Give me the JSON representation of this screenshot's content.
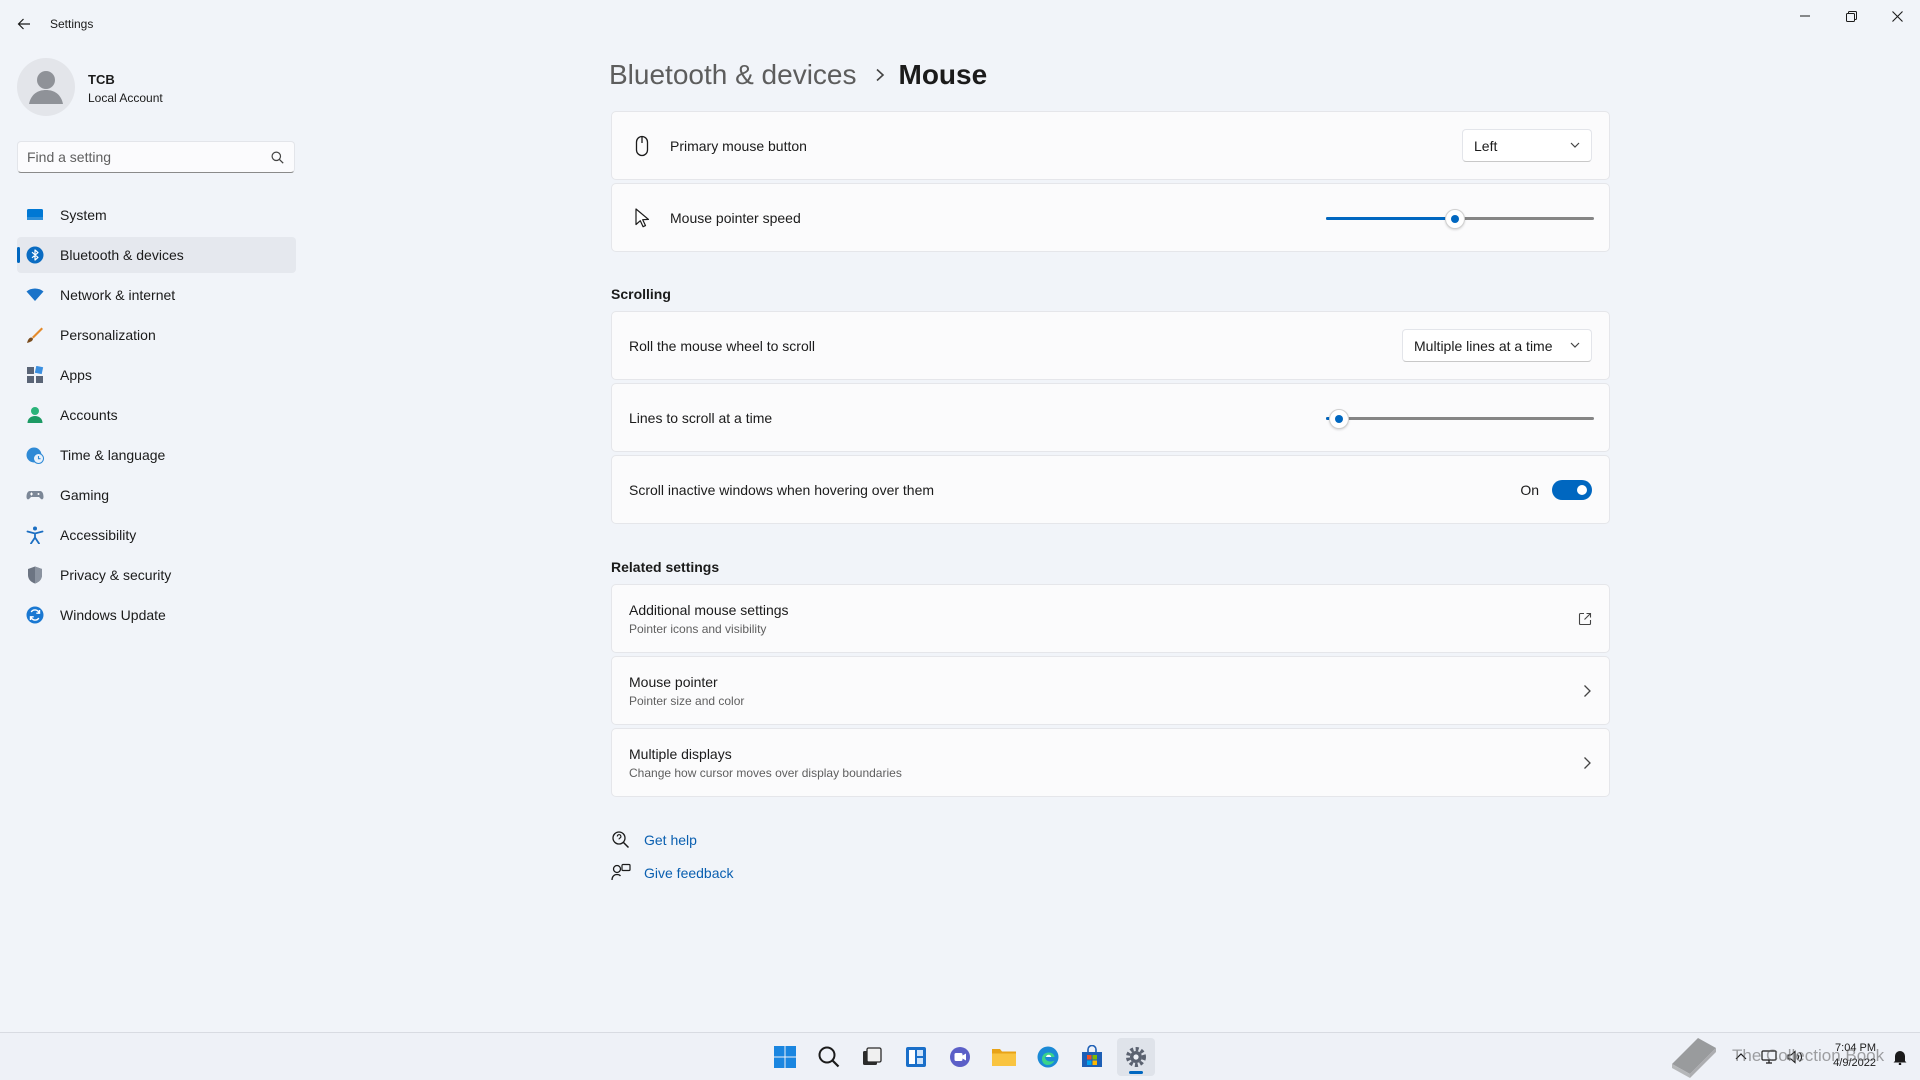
{
  "window": {
    "app_title": "Settings"
  },
  "profile": {
    "name": "TCB",
    "account_type": "Local Account"
  },
  "search": {
    "placeholder": "Find a setting"
  },
  "sidebar": {
    "items": [
      {
        "label": "System",
        "icon": "system-icon"
      },
      {
        "label": "Bluetooth & devices",
        "icon": "bluetooth-icon",
        "active": true
      },
      {
        "label": "Network & internet",
        "icon": "wifi-icon"
      },
      {
        "label": "Personalization",
        "icon": "brush-icon"
      },
      {
        "label": "Apps",
        "icon": "apps-icon"
      },
      {
        "label": "Accounts",
        "icon": "accounts-icon"
      },
      {
        "label": "Time & language",
        "icon": "globe-clock-icon"
      },
      {
        "label": "Gaming",
        "icon": "gamepad-icon"
      },
      {
        "label": "Accessibility",
        "icon": "accessibility-icon"
      },
      {
        "label": "Privacy & security",
        "icon": "shield-icon"
      },
      {
        "label": "Windows Update",
        "icon": "update-icon"
      }
    ]
  },
  "breadcrumb": {
    "parent": "Bluetooth & devices",
    "current": "Mouse"
  },
  "mouse": {
    "primary_button": {
      "label": "Primary mouse button",
      "value": "Left"
    },
    "pointer_speed": {
      "label": "Mouse pointer speed",
      "level": 0.48
    }
  },
  "scrolling": {
    "heading": "Scrolling",
    "wheel": {
      "label": "Roll the mouse wheel to scroll",
      "value": "Multiple lines at a time"
    },
    "lines": {
      "label": "Lines to scroll at a time",
      "level": 0.05
    },
    "inactive": {
      "label": "Scroll inactive windows when hovering over them",
      "state": "On"
    }
  },
  "related": {
    "heading": "Related settings",
    "items": [
      {
        "title": "Additional mouse settings",
        "subtitle": "Pointer icons and visibility",
        "trail": "open-external-icon"
      },
      {
        "title": "Mouse pointer",
        "subtitle": "Pointer size and color",
        "trail": "chevron-right-icon"
      },
      {
        "title": "Multiple displays",
        "subtitle": "Change how cursor moves over display boundaries",
        "trail": "chevron-right-icon"
      }
    ]
  },
  "help": {
    "get_help": "Get help",
    "give_feedback": "Give feedback"
  },
  "taskbar": {
    "time": "7:04 PM",
    "date": "4/9/2022",
    "watermark": "The Collection Book"
  },
  "colors": {
    "accent": "#0067c0",
    "background": "#f1f4f9",
    "card": "#fbfbfc"
  }
}
